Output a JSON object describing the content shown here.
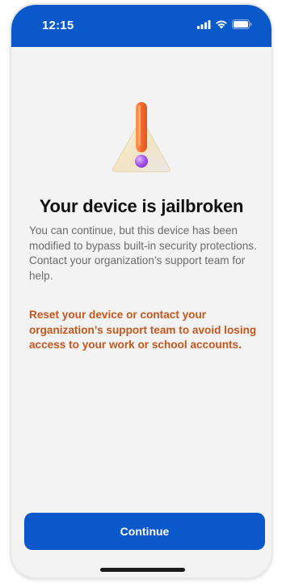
{
  "status_bar": {
    "time": "12:15",
    "background_color": "#0a58c9",
    "icons": [
      "signal-icon",
      "wifi-icon",
      "battery-icon"
    ]
  },
  "hero": {
    "icon": "warning-exclamation-icon",
    "colors": {
      "exclamation": "#f26a2f",
      "dot": "#a659ef",
      "triangle": "#f2e6c4"
    }
  },
  "content": {
    "title": "Your device is jailbroken",
    "body": "You can continue, but this device has been modified to bypass built-in security protections. Contact your organization’s support team for help.",
    "warning": "Reset your device or contact your organization’s support team to avoid losing access to your work or school accounts."
  },
  "actions": {
    "continue_label": "Continue",
    "button_color": "#0a58c9"
  },
  "colors": {
    "warning_text": "#c4571c",
    "body_text": "#6b6b6b",
    "background": "#f3f3f4"
  }
}
